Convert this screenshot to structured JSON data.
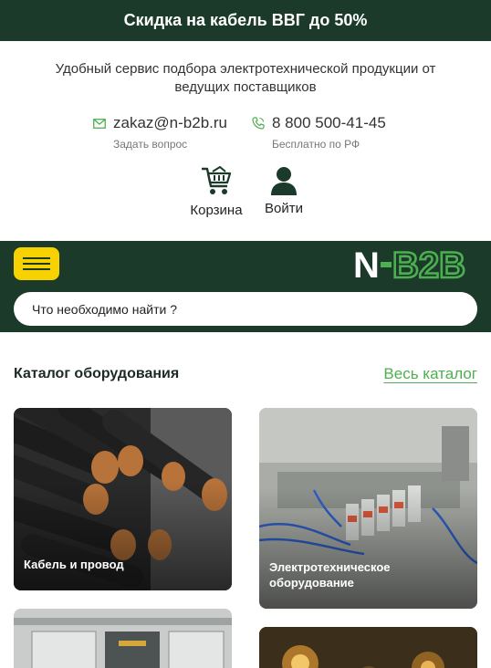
{
  "promo": {
    "text": "Скидка на кабель ВВГ до 50%"
  },
  "header": {
    "tagline": "Удобный сервис подбора электротехнической продукции от ведущих поставщиков",
    "email": {
      "value": "zakaz@n-b2b.ru",
      "caption": "Задать вопрос",
      "icon": "mail-icon"
    },
    "phone": {
      "value": "8 800 500-41-45",
      "caption": "Бесплатно по РФ",
      "icon": "phone-icon"
    },
    "cart": {
      "label": "Корзина",
      "icon": "cart-icon"
    },
    "login": {
      "label": "Войти",
      "icon": "user-icon"
    }
  },
  "navbar": {
    "menu_icon": "hamburger-menu-icon",
    "logo_text": "N-B2B",
    "search_placeholder": "Что необходимо найти ?"
  },
  "catalog": {
    "title": "Каталог оборудования",
    "all_link": "Весь каталог",
    "items": [
      {
        "title": "Кабель и провод"
      },
      {
        "title": "Электротехническое оборудование"
      },
      {
        "title": ""
      },
      {
        "title": ""
      }
    ]
  },
  "colors": {
    "brand_dark": "#1b3a2a",
    "accent_green": "#4caf50",
    "menu_yellow": "#f5d200"
  }
}
